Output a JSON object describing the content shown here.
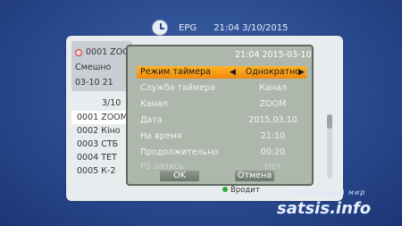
{
  "top": {
    "title": "EPG",
    "datetime": "21:04 3/10/2015"
  },
  "info": {
    "channel": "0001 ZOO",
    "program": "Смешно",
    "date": "03-10 21"
  },
  "list": {
    "pager": "3/10",
    "items": [
      "0001 ZOOM",
      "0002 Кіно",
      "0003 СТБ",
      "0004 ТЕТ",
      "0005 К-2"
    ]
  },
  "bottom_hint": "Вродит",
  "dialog": {
    "datetime": "21:04 2015-03-10",
    "rows": [
      {
        "label": "Режим таймера",
        "value": "Однократно"
      },
      {
        "label": "Служба таймера",
        "value": "Канал"
      },
      {
        "label": "Канал",
        "value": "ZOOM"
      },
      {
        "label": "Дата",
        "value": "2015.03.10"
      },
      {
        "label": "На время",
        "value": "21:10"
      },
      {
        "label": "Продолжительно",
        "value": "00:20"
      },
      {
        "label": "PS запись",
        "value": "Нет"
      }
    ],
    "ok_label": "OK",
    "cancel_label": "Отмена"
  },
  "watermark": {
    "small": "спутниковый мир",
    "main": "satsis.info"
  },
  "colors": {
    "background": "#2a4a8f",
    "selected_row": "#f5a01a",
    "dialog": "#adb7ac"
  }
}
